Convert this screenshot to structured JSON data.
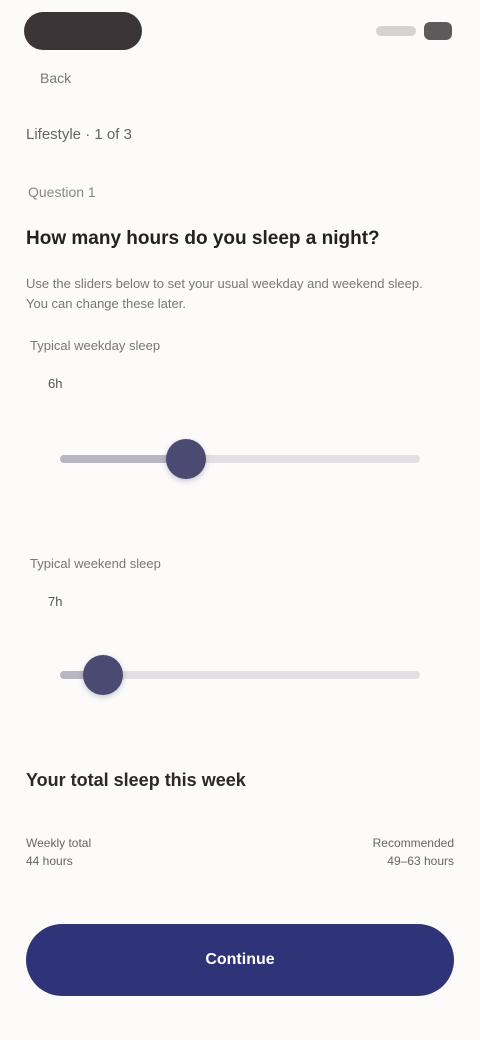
{
  "status_bar": {
    "time": "",
    "signal": "",
    "battery": ""
  },
  "nav": {
    "back_label": "Back"
  },
  "header": {
    "section_label": "Lifestyle · 1 of 3",
    "step_label": "Question 1"
  },
  "question": {
    "title": "How many hours do you sleep a night?",
    "description": "Use the sliders below to set your usual weekday and weekend sleep. You can change these later."
  },
  "sliders": [
    {
      "label": "Typical weekday sleep",
      "value_text": "6h",
      "level": 0.35
    },
    {
      "label": "Typical weekend sleep",
      "value_text": "7h",
      "level": 0.12
    }
  ],
  "summary": {
    "title": "Your total sleep this week",
    "left_label": "Weekly total",
    "left_value": "44 hours",
    "right_label": "Recommended",
    "right_value": "49–63 hours"
  },
  "cta": {
    "label": "Continue"
  },
  "colors": {
    "background": "#fcfbfa",
    "accent": "#2f3378",
    "thumb": "#4a4a72",
    "track": "#e2e0e2"
  }
}
